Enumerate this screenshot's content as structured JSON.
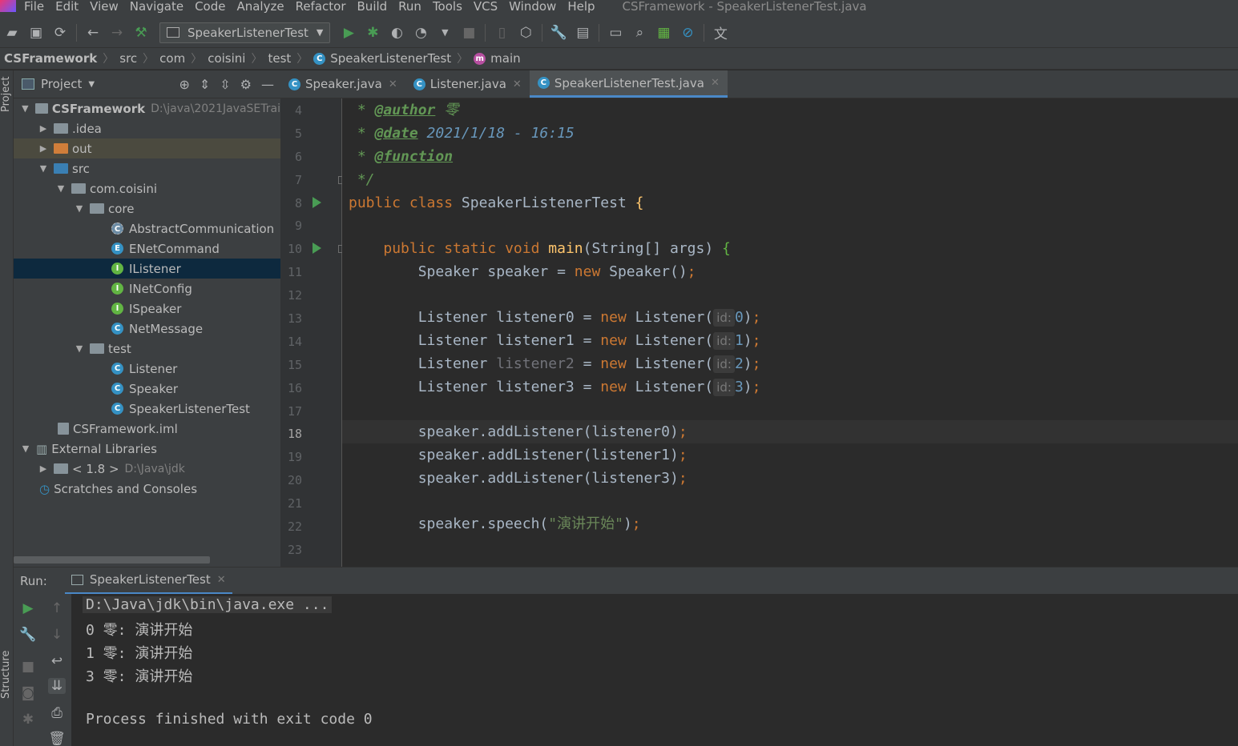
{
  "menubar": {
    "items": [
      "File",
      "Edit",
      "View",
      "Navigate",
      "Code",
      "Analyze",
      "Refactor",
      "Build",
      "Run",
      "Tools",
      "VCS",
      "Window",
      "Help"
    ],
    "window_title": "CSFramework - SpeakerListenerTest.java"
  },
  "toolbar": {
    "run_config": "SpeakerListenerTest"
  },
  "breadcrumb": {
    "items": [
      "CSFramework",
      "src",
      "com",
      "coisini",
      "test",
      "SpeakerListenerTest",
      "main"
    ]
  },
  "sidebar_left": {
    "project_label": "Project",
    "structure_label": "Structure"
  },
  "project_panel": {
    "title": "Project",
    "tree": [
      {
        "label": "CSFramework",
        "path": "D:\\java\\2021JavaSETrai"
      },
      {
        "label": ".idea"
      },
      {
        "label": "out"
      },
      {
        "label": "src"
      },
      {
        "label": "com.coisini"
      },
      {
        "label": "core"
      },
      {
        "label": "AbstractCommunication"
      },
      {
        "label": "ENetCommand"
      },
      {
        "label": "IListener"
      },
      {
        "label": "INetConfig"
      },
      {
        "label": "ISpeaker"
      },
      {
        "label": "NetMessage"
      },
      {
        "label": "test"
      },
      {
        "label": "Listener"
      },
      {
        "label": "Speaker"
      },
      {
        "label": "SpeakerListenerTest"
      },
      {
        "label": "CSFramework.iml"
      },
      {
        "label": "External Libraries"
      },
      {
        "label": "< 1.8 >",
        "path": "D:\\Java\\jdk"
      },
      {
        "label": "Scratches and Consoles"
      }
    ]
  },
  "editor_tabs": [
    {
      "label": "Speaker.java"
    },
    {
      "label": "Listener.java"
    },
    {
      "label": "SpeakerListenerTest.java"
    }
  ],
  "editor": {
    "line_numbers": [
      "4",
      "5",
      "6",
      "7",
      "8",
      "9",
      "10",
      "11",
      "12",
      "13",
      "14",
      "15",
      "16",
      "17",
      "18",
      "19",
      "20",
      "21",
      "22",
      "23"
    ],
    "code": {
      "l4_star": " * ",
      "l4_tag": "@author",
      "l4_val": " 零",
      "l5_star": " * ",
      "l5_tag": "@date",
      "l5_val": " 2021/1/18 - 16:15",
      "l6_star": " * ",
      "l6_tag": "@function",
      "l7": " */",
      "l8_kw": "public class ",
      "l8_name": "SpeakerListenerTest ",
      "l8_brace": "{",
      "l10_indent": "    ",
      "l10_kw": "public static void ",
      "l10_fn": "main",
      "l10_rest": "(String[] args) ",
      "l10_brace": "{",
      "l11_a": "        Speaker speaker = ",
      "l11_kw": "new ",
      "l11_b": "Speaker()",
      "l11_semi": ";",
      "hint_id": "id:",
      "l13_a": "        Listener listener0 = ",
      "l13_b": "Listener(",
      "l13_num": "0",
      "l14_a": "        Listener listener1 = ",
      "l14_num": "1",
      "l15_a": "        Listener ",
      "l15_var": "listener2",
      "l15_b": " = ",
      "l15_num": "2",
      "l16_a": "        Listener listener3 = ",
      "l16_num": "3",
      "new_kw": "new ",
      "close": ")",
      "semi": ";",
      "l18": "        speaker.addListener(listener0)",
      "l19": "        speaker.addListener(listener1)",
      "l20": "        speaker.addListener(listener3)",
      "l22_a": "        speaker.speech(",
      "l22_str": "\"演讲开始\"",
      "l22_b": ")"
    }
  },
  "run_panel": {
    "label": "Run:",
    "tab": "SpeakerListenerTest",
    "console": [
      "D:\\Java\\jdk\\bin\\java.exe ...",
      "0 零: 演讲开始",
      "1 零: 演讲开始",
      "3 零: 演讲开始",
      "Process finished with exit code 0"
    ]
  },
  "colors": {
    "keyword": "#cc7832",
    "function": "#ffc66d",
    "number": "#6897bb",
    "string": "#6a8759",
    "doc": "#629755",
    "accent": "#4a88c7",
    "run_green": "#499c54"
  },
  "icons": [
    "open-icon",
    "save-icon",
    "sync-icon",
    "back-icon",
    "forward-icon",
    "build-icon",
    "run-icon",
    "debug-icon",
    "coverage-icon",
    "profile-icon",
    "stop-icon",
    "sdk-icon",
    "project-structure-icon",
    "settings-icon",
    "search-icon",
    "translate-icon"
  ]
}
